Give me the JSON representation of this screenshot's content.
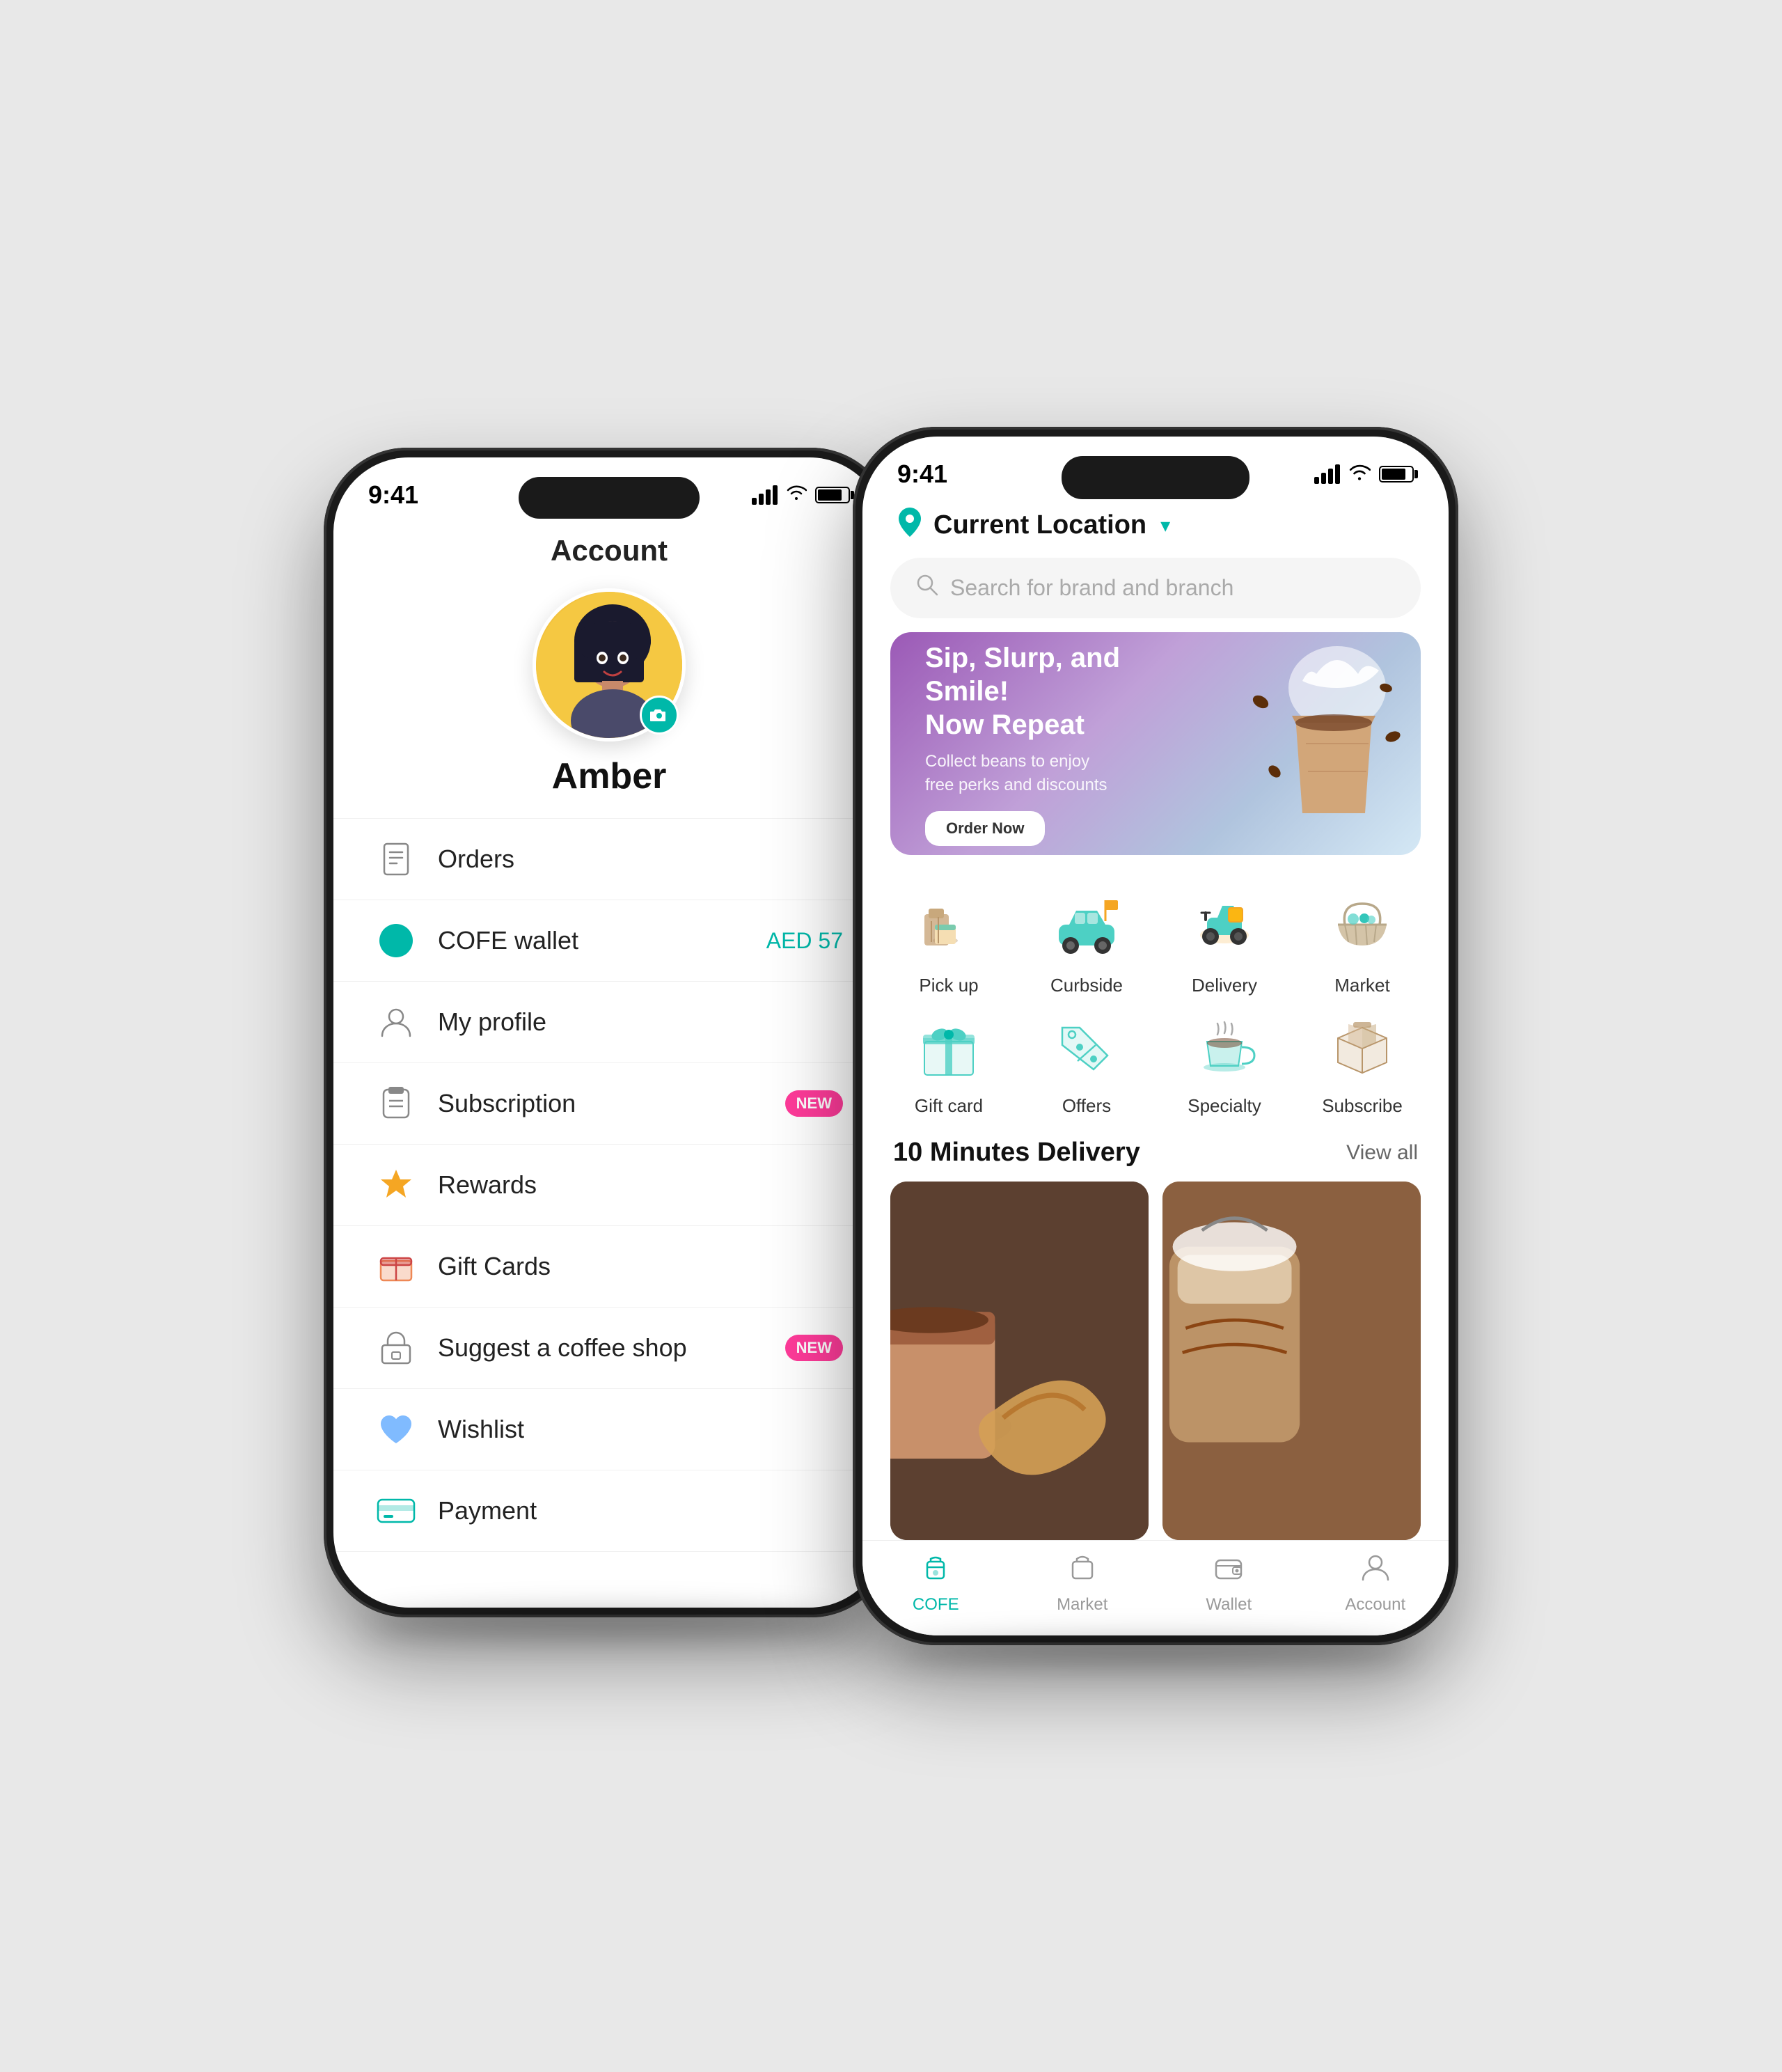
{
  "left_phone": {
    "status": {
      "time": "9:41",
      "signal": true,
      "wifi": true,
      "battery": 80
    },
    "screen_title": "Account",
    "user_name": "Amber",
    "wallet_amount": "AED 57",
    "menu_items": [
      {
        "id": "orders",
        "label": "Orders",
        "icon": "orders",
        "badge": null,
        "extra": null
      },
      {
        "id": "wallet",
        "label": "COFE wallet",
        "icon": "wallet",
        "badge": null,
        "extra": "AED 57"
      },
      {
        "id": "profile",
        "label": "My profile",
        "icon": "profile",
        "badge": null,
        "extra": null
      },
      {
        "id": "subscription",
        "label": "Subscription",
        "icon": "subscription",
        "badge": "NEW",
        "extra": null
      },
      {
        "id": "rewards",
        "label": "Rewards",
        "icon": "rewards",
        "badge": null,
        "extra": null
      },
      {
        "id": "giftcards",
        "label": "Gift Cards",
        "icon": "giftcards",
        "badge": null,
        "extra": null
      },
      {
        "id": "suggest",
        "label": "Suggest a coffee shop",
        "icon": "suggest",
        "badge": "NEW",
        "extra": null
      },
      {
        "id": "wishlist",
        "label": "Wishlist",
        "icon": "wishlist",
        "badge": null,
        "extra": null
      },
      {
        "id": "payment",
        "label": "Payment",
        "icon": "payment",
        "badge": null,
        "extra": null
      }
    ]
  },
  "right_phone": {
    "status": {
      "time": "9:41",
      "signal": true,
      "wifi": true,
      "battery": 80
    },
    "location": {
      "text": "Current Location",
      "has_dropdown": true
    },
    "search": {
      "placeholder": "Search for brand and branch"
    },
    "banner": {
      "title": "Sip, Slurp, and Smile!\nNow Repeat",
      "subtitle": "Collect beans to enjoy\nfree perks and discounts",
      "button_label": "Order Now"
    },
    "categories": [
      {
        "id": "pickup",
        "label": "Pick up",
        "emoji": "🛍️"
      },
      {
        "id": "curbside",
        "label": "Curbside",
        "emoji": "🚗"
      },
      {
        "id": "delivery",
        "label": "Delivery",
        "emoji": "🛵"
      },
      {
        "id": "market",
        "label": "Market",
        "emoji": "🧺"
      },
      {
        "id": "giftcard",
        "label": "Gift card",
        "emoji": "🎁"
      },
      {
        "id": "offers",
        "label": "Offers",
        "emoji": "🏷️"
      },
      {
        "id": "specialty",
        "label": "Specialty",
        "emoji": "☕"
      },
      {
        "id": "subscribe",
        "label": "Subscribe",
        "emoji": "📦"
      }
    ],
    "delivery_section": {
      "title": "10 Minutes Delivery",
      "view_all": "View all"
    },
    "bottom_nav": [
      {
        "id": "cofe",
        "label": "COFE",
        "active": true,
        "emoji": "☕"
      },
      {
        "id": "market",
        "label": "Market",
        "active": false,
        "emoji": "🛒"
      },
      {
        "id": "wallet",
        "label": "Wallet",
        "active": false,
        "emoji": "👛"
      },
      {
        "id": "account",
        "label": "Account",
        "active": false,
        "emoji": "👤"
      }
    ]
  },
  "colors": {
    "primary": "#00b8a9",
    "accent_pink": "#ff3b9a",
    "text_dark": "#111111",
    "text_medium": "#666666",
    "bg_light": "#f5f5f5"
  }
}
